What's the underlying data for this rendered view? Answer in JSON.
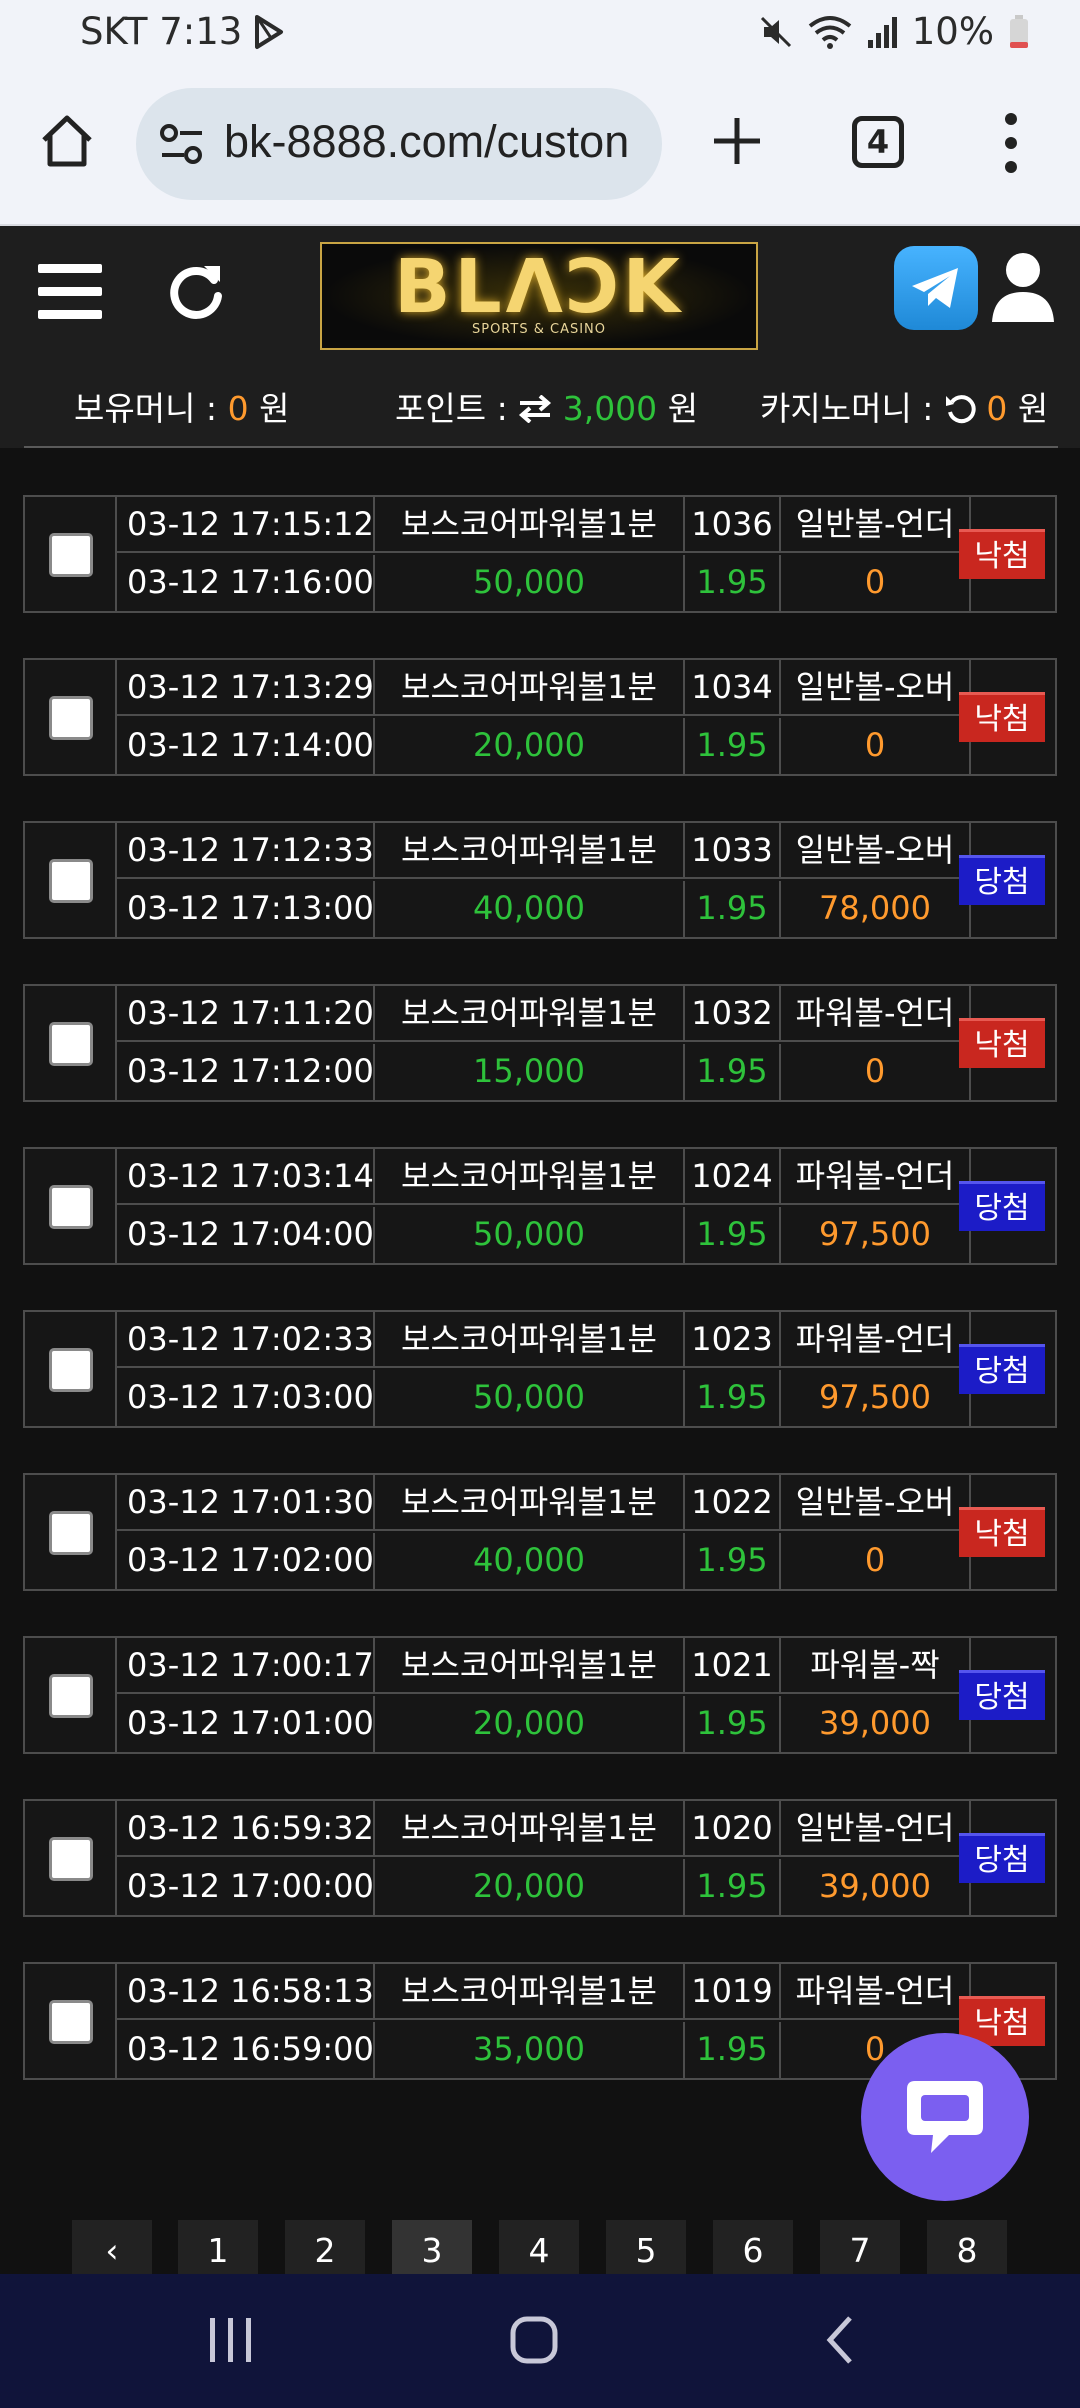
{
  "status_bar": {
    "carrier": "SKT",
    "time": "7:13",
    "battery": "10%"
  },
  "browser": {
    "url": "bk-8888.com/custon",
    "tab_count": "4"
  },
  "site": {
    "logo": "BLΛϽK",
    "logo_sub": "SPORTS & CASINO",
    "balances": {
      "money_label": "보유머니 :",
      "money_value": "0",
      "money_unit": "원",
      "point_label": "포인트 :",
      "point_value": "3,000",
      "point_unit": "원",
      "casino_label": "카지노머니 :",
      "casino_value": "0",
      "casino_unit": "원"
    }
  },
  "bets": [
    {
      "time": "03-12 17:15:12",
      "end": "03-12 17:16:00",
      "game": "보스코어파워볼1분",
      "round": "1036",
      "pick": "일반볼-언더",
      "amount": "50,000",
      "odds": "1.95",
      "payout": "0",
      "result": "낙첨"
    },
    {
      "time": "03-12 17:13:29",
      "end": "03-12 17:14:00",
      "game": "보스코어파워볼1분",
      "round": "1034",
      "pick": "일반볼-오버",
      "amount": "20,000",
      "odds": "1.95",
      "payout": "0",
      "result": "낙첨"
    },
    {
      "time": "03-12 17:12:33",
      "end": "03-12 17:13:00",
      "game": "보스코어파워볼1분",
      "round": "1033",
      "pick": "일반볼-오버",
      "amount": "40,000",
      "odds": "1.95",
      "payout": "78,000",
      "result": "당첨"
    },
    {
      "time": "03-12 17:11:20",
      "end": "03-12 17:12:00",
      "game": "보스코어파워볼1분",
      "round": "1032",
      "pick": "파워볼-언더",
      "amount": "15,000",
      "odds": "1.95",
      "payout": "0",
      "result": "낙첨"
    },
    {
      "time": "03-12 17:03:14",
      "end": "03-12 17:04:00",
      "game": "보스코어파워볼1분",
      "round": "1024",
      "pick": "파워볼-언더",
      "amount": "50,000",
      "odds": "1.95",
      "payout": "97,500",
      "result": "당첨"
    },
    {
      "time": "03-12 17:02:33",
      "end": "03-12 17:03:00",
      "game": "보스코어파워볼1분",
      "round": "1023",
      "pick": "파워볼-언더",
      "amount": "50,000",
      "odds": "1.95",
      "payout": "97,500",
      "result": "당첨"
    },
    {
      "time": "03-12 17:01:30",
      "end": "03-12 17:02:00",
      "game": "보스코어파워볼1분",
      "round": "1022",
      "pick": "일반볼-오버",
      "amount": "40,000",
      "odds": "1.95",
      "payout": "0",
      "result": "낙첨"
    },
    {
      "time": "03-12 17:00:17",
      "end": "03-12 17:01:00",
      "game": "보스코어파워볼1분",
      "round": "1021",
      "pick": "파워볼-짝",
      "amount": "20,000",
      "odds": "1.95",
      "payout": "39,000",
      "result": "당첨"
    },
    {
      "time": "03-12 16:59:32",
      "end": "03-12 17:00:00",
      "game": "보스코어파워볼1분",
      "round": "1020",
      "pick": "일반볼-언더",
      "amount": "20,000",
      "odds": "1.95",
      "payout": "39,000",
      "result": "당첨"
    },
    {
      "time": "03-12 16:58:13",
      "end": "03-12 16:59:00",
      "game": "보스코어파워볼1분",
      "round": "1019",
      "pick": "파워볼-언더",
      "amount": "35,000",
      "odds": "1.95",
      "payout": "0",
      "result": "낙첨"
    }
  ],
  "result_colors": {
    "낙첨": "#c9271f",
    "당첨": "#1c1cc7"
  },
  "pagination": {
    "prev": "‹",
    "pages": [
      "1",
      "2",
      "3",
      "4",
      "5",
      "6",
      "7",
      "8"
    ],
    "current": "3"
  },
  "icons": [
    "play-store-icon",
    "mute-icon",
    "wifi-icon",
    "signal-icon",
    "battery-icon",
    "home-icon",
    "site-info-icon",
    "plus-icon",
    "tabs-icon",
    "overflow-menu-icon",
    "hamburger-icon",
    "refresh-icon",
    "telegram-icon",
    "user-icon",
    "exchange-icon",
    "undo-icon",
    "chat-icon",
    "recents-icon",
    "home-nav-icon",
    "back-icon"
  ]
}
